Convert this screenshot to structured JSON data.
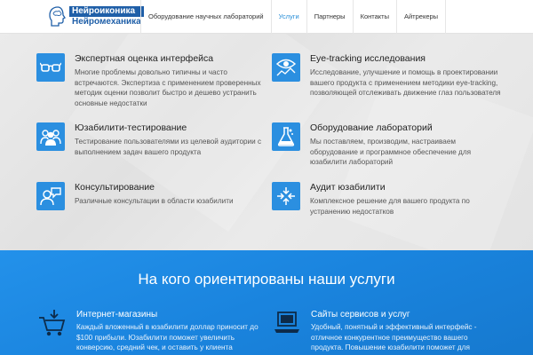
{
  "header": {
    "logo_line1": "Нейроиконика",
    "logo_line2": "Нейромеханика",
    "nav": [
      {
        "label": "Оборудование научных лабораторий",
        "active": false
      },
      {
        "label": "Услуги",
        "active": true
      },
      {
        "label": "Партнеры",
        "active": false
      },
      {
        "label": "Контакты",
        "active": false
      },
      {
        "label": "Айтрекеры",
        "active": false
      }
    ]
  },
  "services": [
    {
      "title": "Экспертная оценка интерфейса",
      "desc": "Многие проблемы довольно типичны и часто встречаются. Экспертиза с применением проверенных методик оценки позволит быстро и дешево устранить основные недостатки",
      "icon": "glasses-icon"
    },
    {
      "title": "Eye-tracking исследования",
      "desc": "Исследование, улучшение и помощь в проектировании вашего продукта с применением методики eye-tracking, позволяющей отслеживать движение глаз пользователя",
      "icon": "eye-chart-icon"
    },
    {
      "title": "Юзабилити-тестирование",
      "desc": "Тестирование пользователями из целевой аудитории с выполнением задач вашего продукта",
      "icon": "users-group-icon"
    },
    {
      "title": "Оборудование лабораторий",
      "desc": "Мы поставляем, производим, настраиваем оборудование и программное обеспечение для юзабилити лабораторий",
      "icon": "flask-icon"
    },
    {
      "title": "Консультирование",
      "desc": "Различные консультации в области юзабилити",
      "icon": "consult-icon"
    },
    {
      "title": "Аудит юзабилити",
      "desc": "Комплексное решение для вашего продукта по устранению недостатков",
      "icon": "compress-arrows-icon"
    }
  ],
  "target": {
    "title": "На кого ориентированы наши услуги",
    "items": [
      {
        "title": "Интернет-магазины",
        "desc": "Каждый вложенный в юзабилити доллар приносит до $100 прибыли. Юзабилити поможет увеличить конверсию, средний чек, и оставить у клиента",
        "icon": "shopping-cart-icon"
      },
      {
        "title": "Сайты сервисов и услуг",
        "desc": "Удобный, понятный и эффективный интерфейс - отличное конкурентное преимущество вашего продукта. Повышение юзабилити поможет для",
        "icon": "laptop-icon"
      }
    ]
  },
  "colors": {
    "accent": "#2b8fe0",
    "blue_section": "#1a86e0",
    "nav_active": "#2a8fd8",
    "logo_blue": "#1f5fa8"
  }
}
